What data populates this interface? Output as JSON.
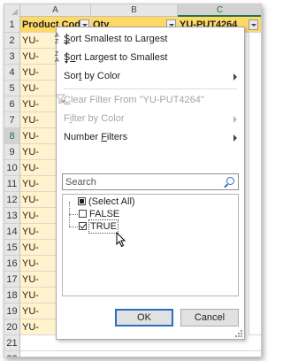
{
  "sheet": {
    "column_letters": [
      "A",
      "B",
      "C"
    ],
    "header_cells": [
      "Product Code",
      "Qty",
      "YU-PUT4264"
    ],
    "row_numbers": [
      "1",
      "2",
      "3",
      "4",
      "5",
      "6",
      "7",
      "8",
      "9",
      "10",
      "11",
      "12",
      "13",
      "14",
      "15",
      "16",
      "17",
      "18",
      "19",
      "20",
      "21",
      "22"
    ],
    "row_prefix": "YU-",
    "colors": {
      "header_fill": "#ffd966",
      "data_fill": "#fff2cc",
      "selected_column_accent": "#217346"
    }
  },
  "filter_menu": {
    "sort_asc": "Sort Smallest to Largest",
    "sort_desc": "Sort Largest to Smallest",
    "sort_by_color": "Sort by Color",
    "clear_filter": "Clear Filter From \"YU-PUT4264\"",
    "filter_by_color": "Filter by Color",
    "number_filters": "Number Filters",
    "search_placeholder": "Search",
    "items": [
      {
        "label": "(Select All)",
        "state": "partial"
      },
      {
        "label": "FALSE",
        "state": "unchecked"
      },
      {
        "label": "TRUE",
        "state": "checked"
      }
    ],
    "ok_label": "OK",
    "cancel_label": "Cancel"
  }
}
